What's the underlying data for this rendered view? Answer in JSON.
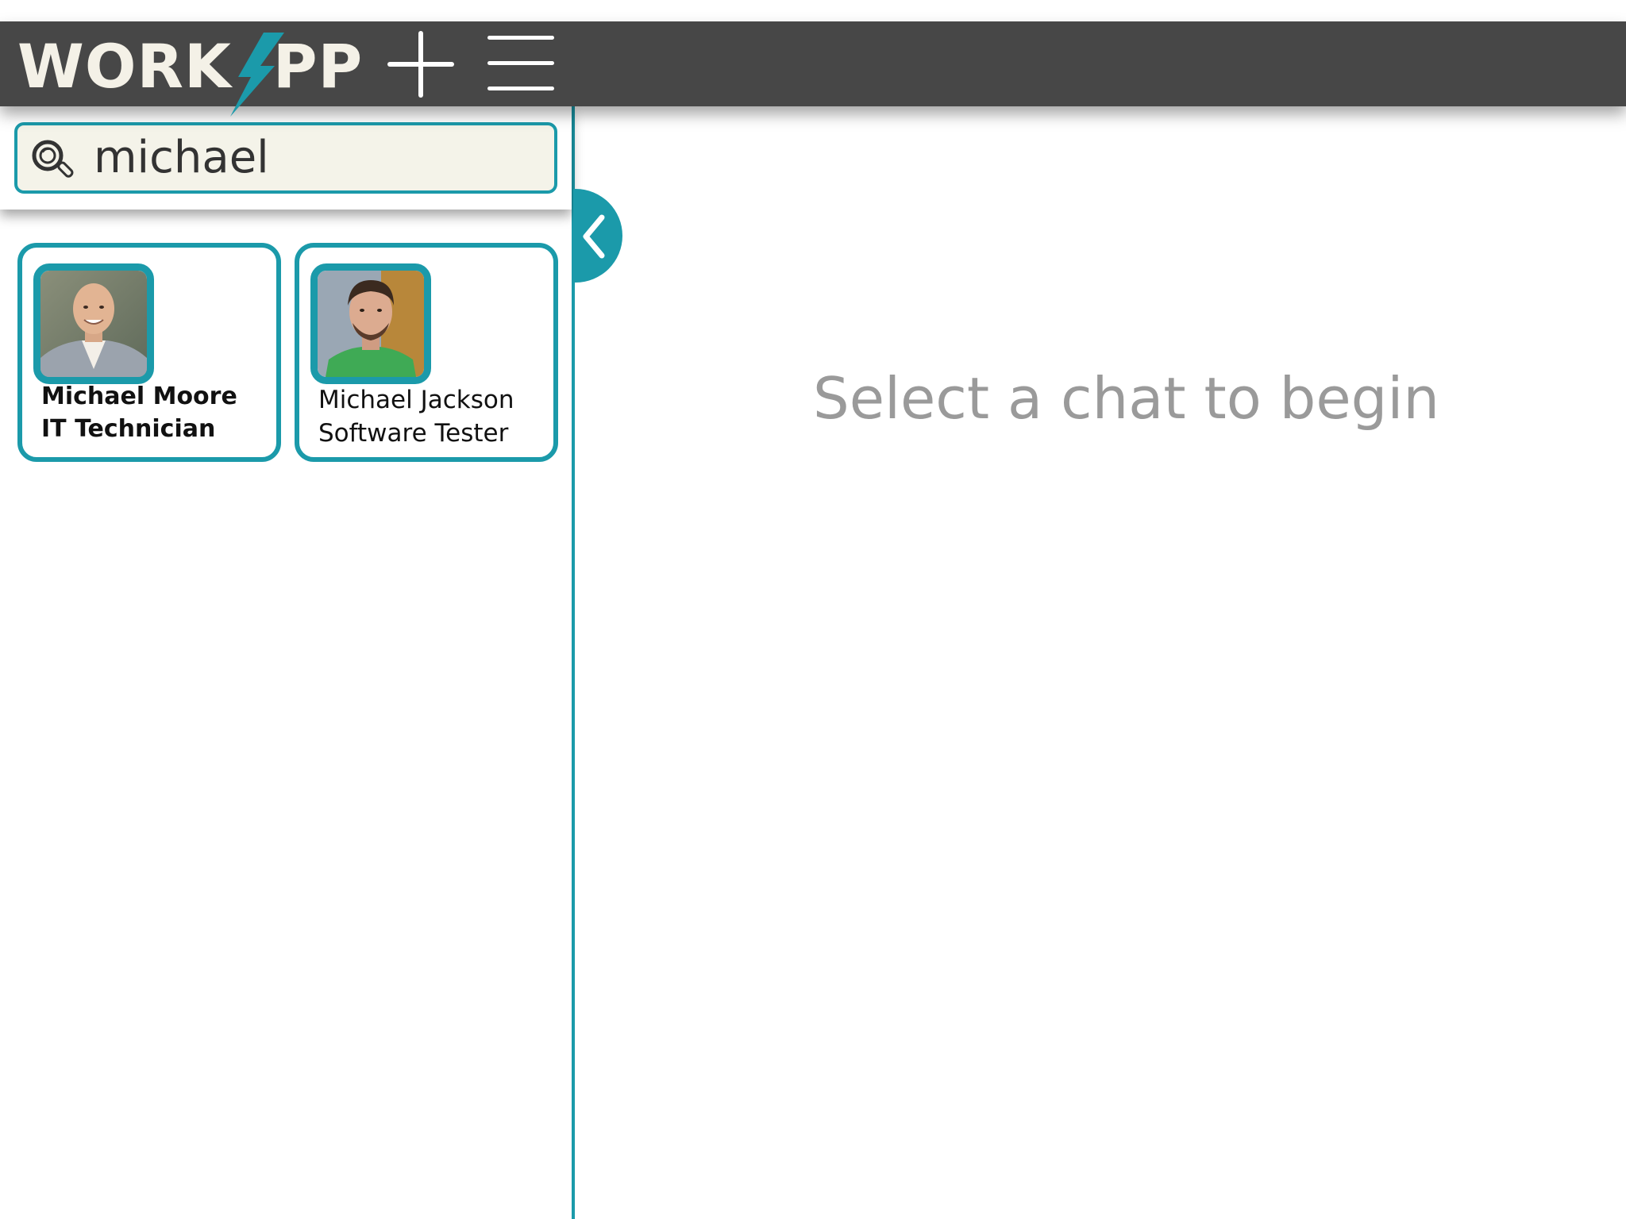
{
  "app": {
    "logo_left": "WORK",
    "logo_right": "PP"
  },
  "colors": {
    "header_bg": "#474747",
    "accent": "#1b9aaa",
    "search_bg": "#f4f3e9",
    "placeholder_text": "#9a9a9a"
  },
  "toolbar": {
    "add_icon": "plus-icon",
    "menu_icon": "hamburger-menu-icon"
  },
  "search": {
    "value": "michael",
    "icon": "search-icon"
  },
  "sidebar": {
    "collapse_icon": "chevron-left-icon"
  },
  "results": [
    {
      "name": "Michael Moore",
      "role": "IT Technician"
    },
    {
      "name": "Michael Jackson",
      "role": "Software Tester"
    }
  ],
  "main": {
    "empty_message": "Select a chat to begin"
  }
}
